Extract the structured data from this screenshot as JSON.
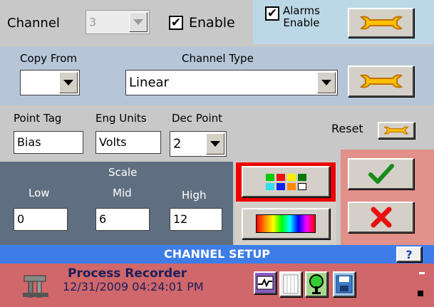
{
  "channel": {
    "label": "Channel",
    "value": "3"
  },
  "enable": {
    "label": "Enable",
    "checked": true
  },
  "alarms_enable": {
    "label": "Alarms\nEnable",
    "checked": true
  },
  "copy_from": {
    "label": "Copy From",
    "value": ""
  },
  "channel_type": {
    "label": "Channel Type",
    "value": "Linear"
  },
  "point_tag": {
    "label": "Point Tag",
    "value": "Bias"
  },
  "eng_units": {
    "label": "Eng Units",
    "value": "Volts"
  },
  "dec_point": {
    "label": "Dec Point",
    "value": "2"
  },
  "reset": {
    "label": "Reset"
  },
  "scale": {
    "title": "Scale",
    "low": {
      "label": "Low",
      "value": "0"
    },
    "mid": {
      "label": "Mid",
      "value": "6"
    },
    "high": {
      "label": "High",
      "value": "12"
    }
  },
  "palette_colors": [
    "#00cc00",
    "#ee1111",
    "#ffee00",
    "#007700",
    "#33ddee",
    "#1122ee",
    "#ff8800",
    "#ffffff"
  ],
  "title_bar": {
    "text": "CHANNEL SETUP",
    "help": "?"
  },
  "status": {
    "app_name": "Process Recorder",
    "datetime": "12/31/2009 04:24:01 PM"
  },
  "colors": {
    "title_bar": "#3e7de8",
    "status_bar": "#d0676a",
    "scale_panel": "#5f6f81",
    "ok_cancel_panel": "#e2908a",
    "top_panel": "#b6c6d8"
  }
}
